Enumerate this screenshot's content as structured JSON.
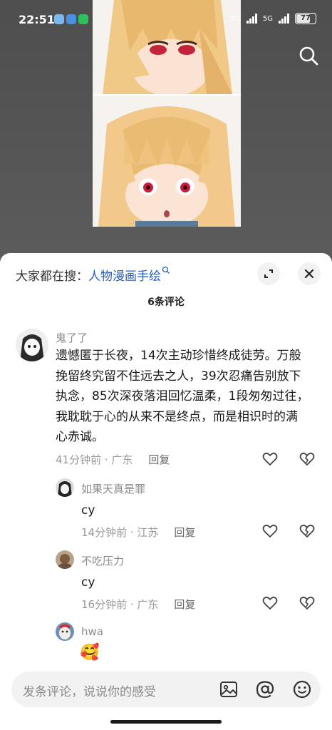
{
  "status_bar": {
    "time": "22:51",
    "network_1": "5G",
    "network_2": "5G",
    "battery": "77",
    "battery_level": 0.77
  },
  "search": {
    "label": "大家都在搜：",
    "keyword": "人物漫画手绘"
  },
  "comments_header": {
    "title": "6条评论"
  },
  "comments": [
    {
      "user": "鬼了了",
      "text": "遗憾匿于长夜，14次主动珍惜终成徒劳。万般挽留终究留不住远去之人，39次忍痛告别放下执念，85次深夜落泪回忆温柔，1段匆匆过往，我耽耽于心的从来不是终点，而是相识时的满心赤诚。",
      "time": "41分钟前",
      "location": "广东",
      "reply": "回复"
    },
    {
      "user": "如果天真是罪",
      "text": "cy",
      "time": "14分钟前",
      "location": "江苏",
      "reply": "回复"
    },
    {
      "user": "不吃压力",
      "text": "cy",
      "time": "16分钟前",
      "location": "广东",
      "reply": "回复"
    },
    {
      "user": "hwa",
      "text": "🥰"
    }
  ],
  "input": {
    "placeholder": "发条评论，说说你的感受"
  },
  "icons": {
    "search": "search-icon",
    "expand": "expand-icon",
    "close": "close-icon",
    "like": "heart-icon",
    "dislike": "broken-heart-icon",
    "image": "image-icon",
    "mention": "at-icon",
    "emoji": "emoji-icon"
  }
}
